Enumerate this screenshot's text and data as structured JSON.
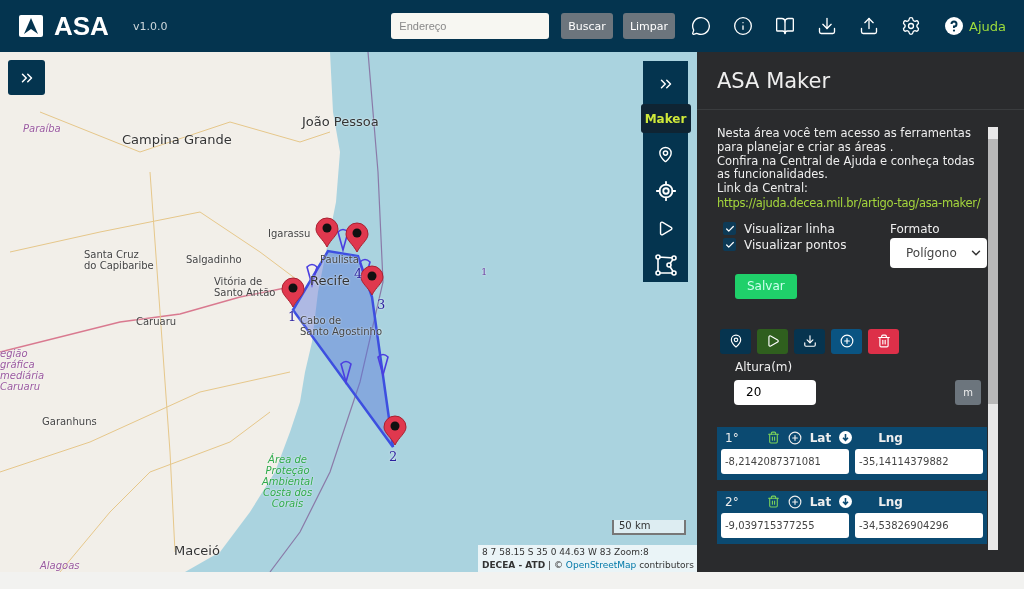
{
  "header": {
    "logo": "ASA",
    "version": "v1.0.0",
    "search": {
      "placeholder": "Endereço"
    },
    "buttons": [
      "Buscar",
      "Limpar"
    ],
    "help": "Ajuda"
  },
  "map": {
    "labels": [
      {
        "kind": "city",
        "lines": [
          "João Pessoa"
        ]
      },
      {
        "kind": "region",
        "lines": [
          "Paraíba"
        ]
      },
      {
        "kind": "city",
        "lines": [
          "Campina Grande"
        ]
      },
      {
        "kind": "town",
        "lines": [
          "Igarassu"
        ]
      },
      {
        "kind": "town",
        "lines": [
          "Santa Cruz",
          "do Capibaribe"
        ]
      },
      {
        "kind": "town",
        "lines": [
          "Salgadinho"
        ]
      },
      {
        "kind": "town",
        "lines": [
          "Paulista"
        ]
      },
      {
        "kind": "vertex",
        "lines": [
          "4"
        ]
      },
      {
        "kind": "stray",
        "lines": [
          "1"
        ]
      },
      {
        "kind": "city",
        "lines": [
          "Recife"
        ]
      },
      {
        "kind": "town",
        "lines": [
          "Vitória de",
          "Santo Antão"
        ]
      },
      {
        "kind": "vertex",
        "lines": [
          "3"
        ]
      },
      {
        "kind": "town",
        "lines": [
          "Cabo de",
          "Santo Agostinho"
        ]
      },
      {
        "kind": "vertex",
        "lines": [
          "1"
        ]
      },
      {
        "kind": "town",
        "lines": [
          "Caruaru"
        ]
      },
      {
        "kind": "region",
        "lines": [
          "egião",
          "gráfica",
          "mediária",
          "Caruaru"
        ]
      },
      {
        "kind": "town",
        "lines": [
          "Garanhuns"
        ]
      },
      {
        "kind": "vertex",
        "lines": [
          "2"
        ]
      },
      {
        "kind": "park",
        "lines": [
          "Área de",
          "Proteção",
          "Ambiental",
          "Costa dos",
          "Corais"
        ]
      },
      {
        "kind": "city",
        "lines": [
          "Maceió"
        ]
      },
      {
        "kind": "region",
        "lines": [
          "Alagoas"
        ]
      }
    ],
    "scale": "50 km",
    "coordinates": "8 7 58.15 S 35 0 44.63 W 83 Zoom:8",
    "attribution": {
      "prefix": "**DECEA - ATD** | ©",
      "link": "OpenStreetMap",
      "suffix": "contributors"
    }
  },
  "rail": [
    {
      "kind": "text",
      "label": "Maker",
      "selected": true
    },
    {
      "kind": "pin",
      "selected": false
    },
    {
      "kind": "target",
      "selected": false
    },
    {
      "kind": "play",
      "selected": false
    },
    {
      "kind": "polygon",
      "selected": false
    }
  ],
  "panel": {
    "title": "ASA Maker",
    "intro": [
      "Nesta área você tem acesso as ferramentas para planejar e criar as áreas .",
      "Confira na Central de Ajuda e conheça todas as funcionalidades.",
      "Link da Central:"
    ],
    "link": "https://ajuda.decea.mil.br/artigo-tag/asa-maker/",
    "checkboxes": [
      {
        "label": "Visualizar linha",
        "checked": true
      },
      {
        "label": "Visualizar pontos",
        "checked": true
      }
    ],
    "format": {
      "label": "Formato",
      "value": "Polígono"
    },
    "save": "Salvar",
    "actions": [
      {
        "kind": "locate"
      },
      {
        "kind": "run"
      },
      {
        "kind": "download"
      },
      {
        "kind": "add"
      },
      {
        "kind": "delete"
      }
    ],
    "height": {
      "label": "Altura(m)",
      "value": "20",
      "unit": "m"
    },
    "points": [
      {
        "ordinal": "1°",
        "lat_label": "Lat",
        "lng_label": "Lng",
        "lat": "-8,2142087371081",
        "lng": "-35,14114379882"
      },
      {
        "ordinal": "2°",
        "lat_label": "Lat",
        "lng_label": "Lng",
        "lat": "-9,039715377255",
        "lng": "-34,53826904296"
      }
    ]
  }
}
